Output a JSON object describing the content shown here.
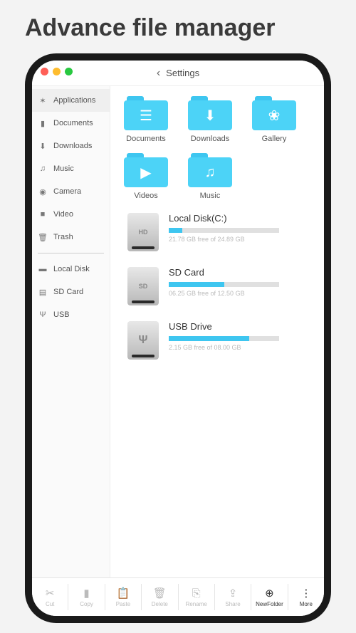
{
  "page_title": "Advance file manager",
  "header": {
    "title": "Settings"
  },
  "sidebar": {
    "items": [
      {
        "label": "Applications",
        "icon": "apps"
      },
      {
        "label": "Documents",
        "icon": "doc"
      },
      {
        "label": "Downloads",
        "icon": "download"
      },
      {
        "label": "Music",
        "icon": "music"
      },
      {
        "label": "Camera",
        "icon": "camera"
      },
      {
        "label": "Video",
        "icon": "video"
      },
      {
        "label": "Trash",
        "icon": "trash"
      }
    ],
    "storage": [
      {
        "label": "Local Disk",
        "icon": "disk"
      },
      {
        "label": "SD Card",
        "icon": "sd"
      },
      {
        "label": "USB",
        "icon": "usb"
      }
    ]
  },
  "folders": [
    {
      "label": "Documents"
    },
    {
      "label": "Downloads"
    },
    {
      "label": "Gallery"
    },
    {
      "label": "Videos"
    },
    {
      "label": "Music"
    }
  ],
  "drives": [
    {
      "name": "Local Disk(C:)",
      "badge": "HD",
      "fill_pct": 12,
      "free_text": "21.78 GB free of 24.89 GB"
    },
    {
      "name": "SD Card",
      "badge": "SD",
      "fill_pct": 50,
      "free_text": "06.25 GB free of 12.50 GB"
    },
    {
      "name": "USB Drive",
      "badge": "⌁",
      "fill_pct": 73,
      "free_text": "2.15 GB free of 08.00 GB"
    }
  ],
  "bottom": {
    "items": [
      {
        "label": "Cut"
      },
      {
        "label": "Copy"
      },
      {
        "label": "Paste"
      },
      {
        "label": "Delete"
      },
      {
        "label": "Rename"
      },
      {
        "label": "Share"
      },
      {
        "label": "NewFolder"
      },
      {
        "label": "More"
      }
    ]
  }
}
